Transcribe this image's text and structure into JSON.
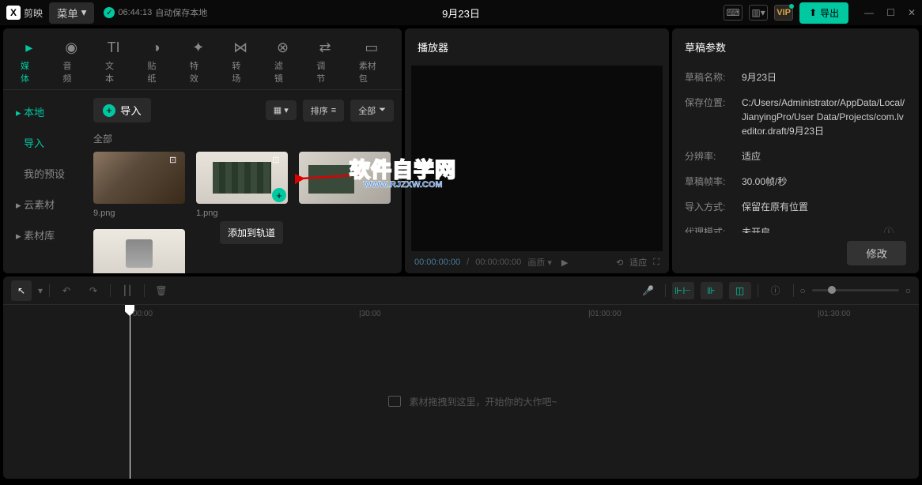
{
  "titlebar": {
    "appName": "剪映",
    "menuLabel": "菜单",
    "autosaveTime": "06:44:13",
    "autosaveText": "自动保存本地",
    "documentTitle": "9月23日",
    "vipLabel": "VIP",
    "exportLabel": "导出"
  },
  "mediaTabs": [
    {
      "icon": "▸",
      "label": "媒体",
      "active": true
    },
    {
      "icon": "◉",
      "label": "音频"
    },
    {
      "icon": "TI",
      "label": "文本"
    },
    {
      "icon": "◑",
      "label": "贴纸"
    },
    {
      "icon": "✦",
      "label": "特效"
    },
    {
      "icon": "⋈",
      "label": "转场"
    },
    {
      "icon": "⊗",
      "label": "滤镜"
    },
    {
      "icon": "⇄",
      "label": "调节"
    },
    {
      "icon": "▭",
      "label": "素材包"
    }
  ],
  "mediaSidebar": [
    {
      "label": "▸ 本地",
      "active": true
    },
    {
      "label": "导入",
      "active": true
    },
    {
      "label": "我的预设"
    },
    {
      "label": "▸ 云素材"
    },
    {
      "label": "▸ 素材库"
    }
  ],
  "mediaToolbar": {
    "importLabel": "导入",
    "sortLabel": "排序",
    "filterLabel": "全部",
    "sectionLabel": "全部"
  },
  "mediaItems": [
    {
      "caption": "9.png"
    },
    {
      "caption": "1.png"
    },
    {
      "caption": ""
    },
    {
      "caption": ""
    }
  ],
  "tooltip": "添加到轨道",
  "player": {
    "title": "播放器",
    "currentTime": "00:00:00:00",
    "totalTime": "00:00:00:00",
    "qualityLabel": "画质",
    "fitLabel": "适应"
  },
  "draft": {
    "title": "草稿参数",
    "rows": [
      {
        "label": "草稿名称:",
        "value": "9月23日"
      },
      {
        "label": "保存位置:",
        "value": "C:/Users/Administrator/AppData/Local/JianyingPro/User Data/Projects/com.lveditor.draft/9月23日"
      },
      {
        "label": "分辨率:",
        "value": "适应"
      },
      {
        "label": "草稿帧率:",
        "value": "30.00帧/秒"
      },
      {
        "label": "导入方式:",
        "value": "保留在原有位置"
      },
      {
        "label": "代理模式:",
        "value": "未开启"
      }
    ],
    "modifyLabel": "修改"
  },
  "timeline": {
    "marks": [
      "00:00",
      "|30:00",
      "|01:00:00",
      "|01:30:00"
    ],
    "emptyText": "素材拖拽到这里，开始你的大作吧~"
  },
  "watermark": {
    "text": "软件自学网",
    "url": "WWW.RJZXW.COM"
  }
}
